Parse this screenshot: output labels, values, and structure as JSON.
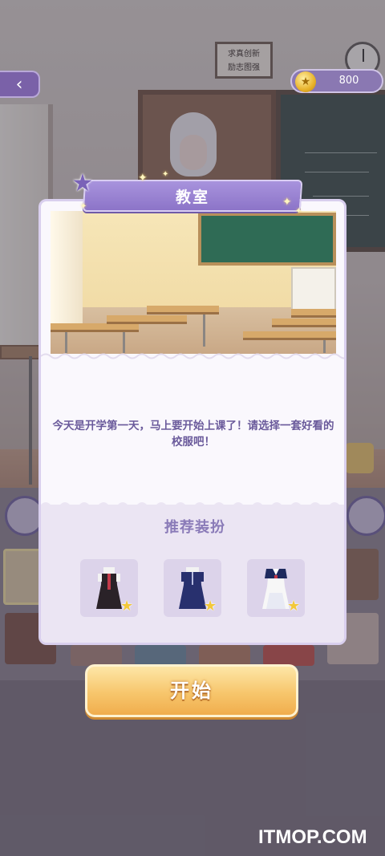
{
  "header": {
    "coins": "800",
    "motto_line1": "求真创新",
    "motto_line2": "励志图强"
  },
  "dialog": {
    "title": "教室",
    "message": "今天是开学第一天，马上要开始上课了！请选择一套好看的校服吧！",
    "recommend_title": "推荐装扮",
    "outfits": [
      {
        "name": "black-pinafore-uniform",
        "colors": [
          "#2a2228",
          "#c23a4a"
        ]
      },
      {
        "name": "navy-dress-uniform",
        "colors": [
          "#28306e",
          "#f2f2f2"
        ]
      },
      {
        "name": "sailor-uniform",
        "colors": [
          "#f7f7f7",
          "#1e2a5e"
        ]
      }
    ]
  },
  "start_button": {
    "label": "开始"
  },
  "watermark": "ITMOP.COM",
  "colors": {
    "accent_purple": "#8c74c8",
    "text_purple": "#6a5a9b",
    "button_gold": "#f7c66c"
  },
  "icons": {
    "back": "back-arrow-icon",
    "coin": "coin-icon",
    "star": "star-icon"
  }
}
